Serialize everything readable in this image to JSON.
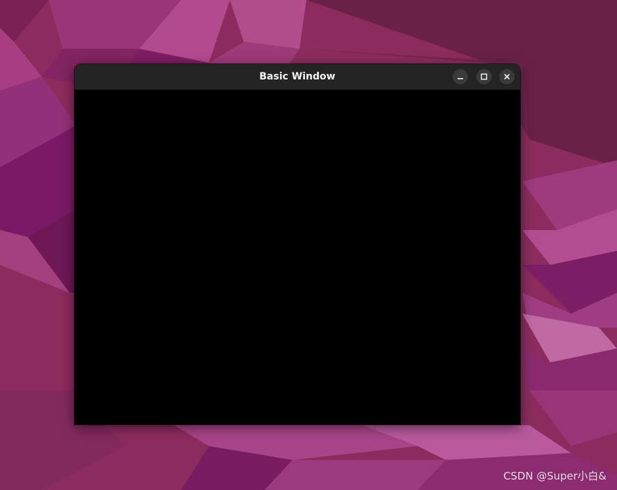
{
  "desktop": {
    "background_color": "#8a2a5c"
  },
  "window": {
    "title": "Basic Window",
    "titlebar_color": "#242424",
    "content_color": "#000000",
    "controls": {
      "minimize": "minimize-icon",
      "maximize": "maximize-icon",
      "close": "close-icon"
    }
  },
  "watermark": {
    "text": "CSDN @Super小白&"
  }
}
